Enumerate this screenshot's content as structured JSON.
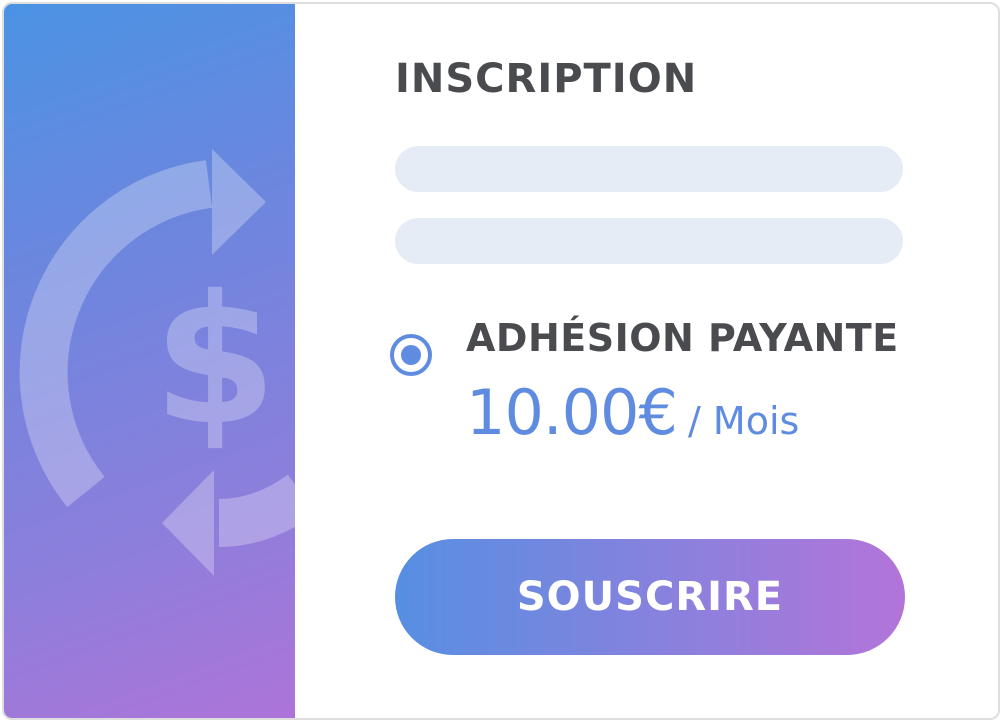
{
  "form": {
    "title": "INSCRIPTION",
    "field_1": {
      "value": "",
      "placeholder": ""
    },
    "field_2": {
      "value": "",
      "placeholder": ""
    }
  },
  "plan": {
    "selected": true,
    "label": "ADHÉSION PAYANTE",
    "price": "10.00€",
    "period": "/ Mois"
  },
  "actions": {
    "subscribe_label": "SOUSCRIRE"
  },
  "decor": {
    "icon": "recurring-dollar-icon"
  },
  "colors": {
    "accent": "#5f8be0",
    "title_text": "#494b4f",
    "field_bg": "#e6ecf5",
    "gradient_start": "#4b93e4",
    "gradient_end": "#ad74d8"
  }
}
